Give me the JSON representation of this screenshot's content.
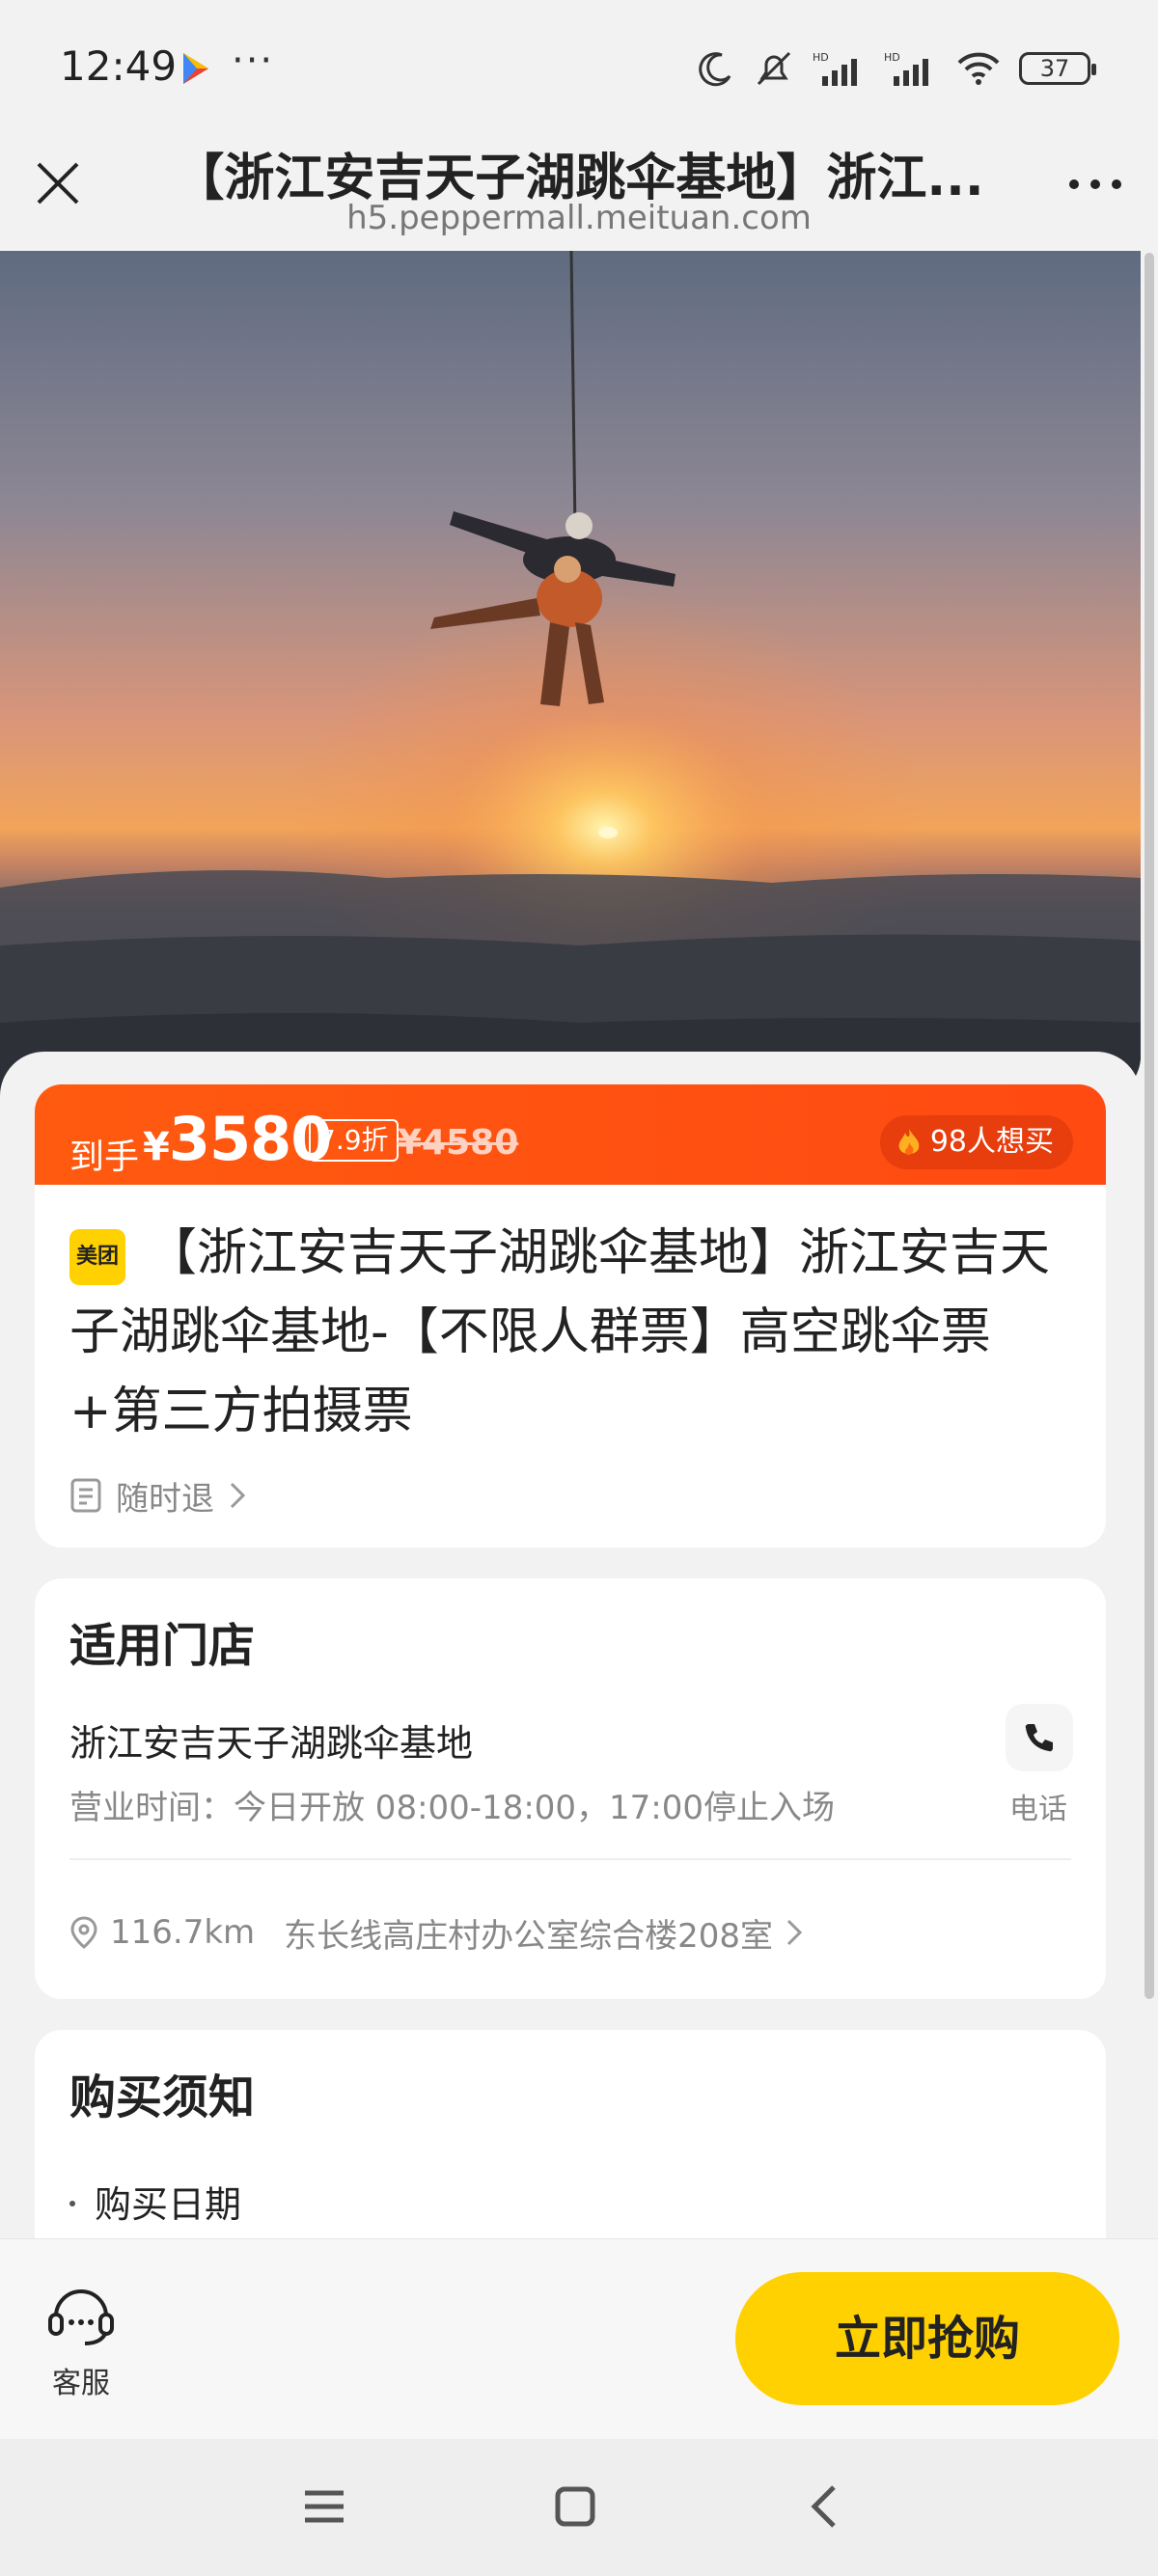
{
  "status_bar": {
    "time": "12:49",
    "more": "···",
    "battery": "37"
  },
  "browser": {
    "title": "【浙江安吉天子湖跳伞基地】浙江...",
    "url": "h5.peppermall.meituan.com"
  },
  "price_banner": {
    "label": "到手",
    "currency": "¥",
    "price": "3580",
    "discount": "7.9折",
    "original_price": "¥4580",
    "want_count": "98人想买"
  },
  "product": {
    "brand_badge": "美团",
    "title": "【浙江安吉天子湖跳伞基地】浙江安吉天子湖跳伞基地-【不限人群票】高空跳伞票+第三方拍摄票",
    "refund_policy": "随时退"
  },
  "store": {
    "heading": "适用门店",
    "name": "浙江安吉天子湖跳伞基地",
    "hours": "营业时间：今日开放 08:00-18:00，17:00停止入场",
    "phone_label": "电话",
    "distance": "116.7km",
    "address": "东长线高庄村办公室综合楼208室"
  },
  "notice": {
    "heading": "购买须知",
    "first_item": "购买日期"
  },
  "actions": {
    "service_label": "客服",
    "buy_label": "立即抢购"
  },
  "colors": {
    "accent_orange": "#ff5a10",
    "buy_yellow": "#ffd100"
  }
}
